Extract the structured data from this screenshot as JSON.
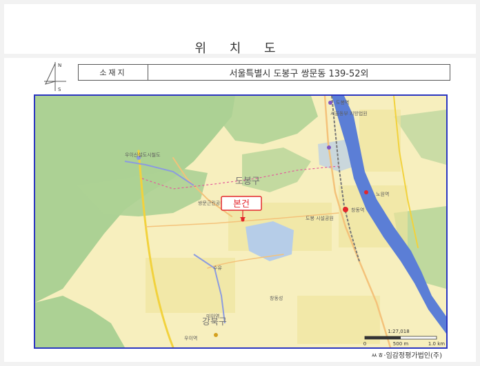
{
  "document": {
    "title": "위 치 도",
    "location_label": "소재지",
    "location_value": "서울특별시 도봉구 쌍문동 139-52외",
    "source": "ㅆㅎ·임감정평가법인(주)"
  },
  "north_arrow": {
    "north": "N",
    "south": "S"
  },
  "map": {
    "subject_marker": "본건",
    "district_labels": {
      "dobong": "도봉구",
      "gangbuk": "강북구"
    },
    "place_labels": {
      "dobong_station": "도봉역",
      "seoul_dobong_office": "서울동부 지방법원",
      "changdong_station": "창동역",
      "ssangmun_park": "쌍문근린공원",
      "dobong_city_park": "도봉 시설공원",
      "nowon_station": "노원역",
      "uijeongbu_office": "우이신설도시철도",
      "suyu": "수유",
      "mia": "미아역",
      "jangyong": "창동성",
      "ui_station": "우이역"
    },
    "scale_text": "1:27,018",
    "scale_ticks": [
      "0",
      "500 m",
      "1.0 km"
    ]
  },
  "colors": {
    "map_frame": "#2a35c0",
    "marker": "#e3262b",
    "river": "#5b7ed6",
    "mountain": "#a8cf92",
    "land": "#f7efbe"
  }
}
